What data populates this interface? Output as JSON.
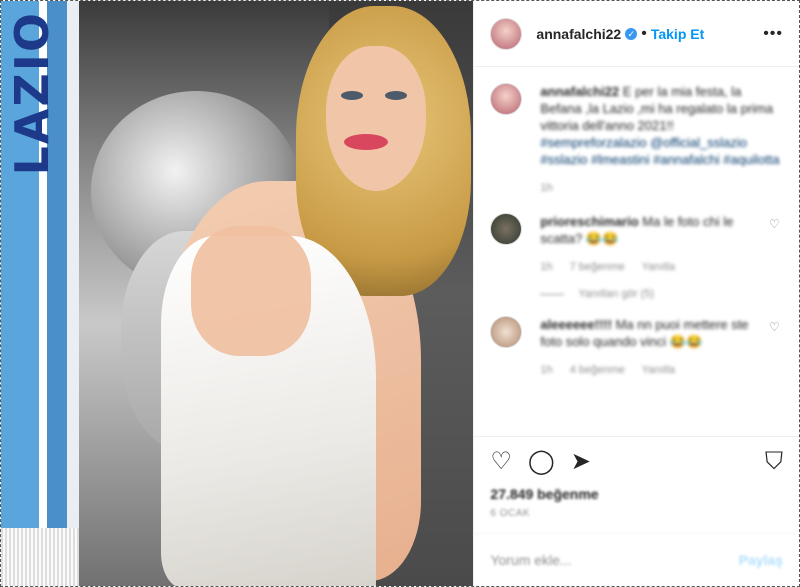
{
  "header": {
    "username": "annafalchi22",
    "follow_label": "Takip Et",
    "more_label": "•••"
  },
  "photo": {
    "scarf_text": "LAZIO"
  },
  "caption": {
    "username": "annafalchi22",
    "text": "E per la mia festa, la Befana ,la Lazio ,mi ha regalato la prima vittoria dell'anno 2021!!",
    "hashtags": "#sempreforzalazio @official_sslazio #sslazio #lmeastini #annafalchi #aquilotta",
    "time": "1h"
  },
  "comments": [
    {
      "username": "prioreschimario",
      "text": "Ma le foto chi le scatta? 😂😂",
      "time": "1h",
      "likes": "7 beğenme",
      "reply": "Yanıtla",
      "view_replies": "Yanıtları gör (5)"
    },
    {
      "username": "aleeeeee!!!!",
      "text": "Ma nn puoi mettere ste foto solo quando vinci 😂😂",
      "time": "1h",
      "likes": "4 beğenme",
      "reply": "Yanıtla"
    }
  ],
  "actions": {
    "like_icon": "heart-icon",
    "comment_icon": "comment-icon",
    "share_icon": "share-icon",
    "save_icon": "bookmark-icon"
  },
  "likes_count": "27.849 beğenme",
  "date": "6 OCAK",
  "add_comment": {
    "placeholder": "Yorum ekle...",
    "post_label": "Paylaş"
  },
  "colors": {
    "accent": "#0095f6",
    "text": "#262626",
    "muted": "#8e8e8e"
  }
}
